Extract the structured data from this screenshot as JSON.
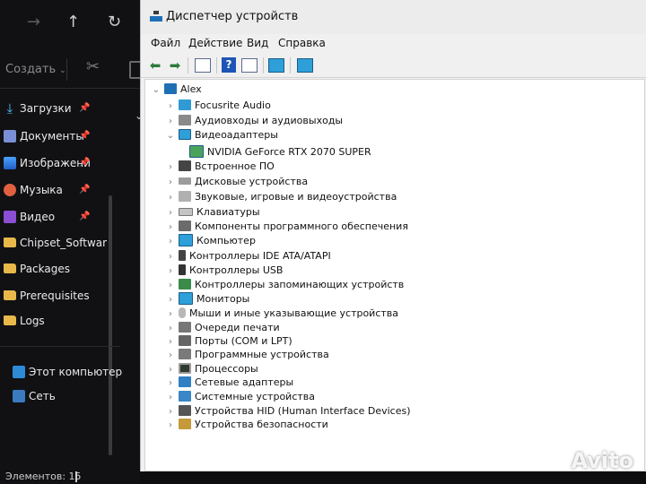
{
  "explorer": {
    "toolbar": {
      "create_label": "Создать"
    },
    "nav": [
      {
        "label": "Загрузки"
      },
      {
        "label": "Документы"
      },
      {
        "label": "Изображени"
      },
      {
        "label": "Музыка"
      },
      {
        "label": "Видео"
      },
      {
        "label": "Chipset_Softwar"
      },
      {
        "label": "Packages"
      },
      {
        "label": "Prerequisites"
      },
      {
        "label": "Logs"
      },
      {
        "label": "Этот компьютер"
      },
      {
        "label": "Сеть"
      }
    ],
    "status": "Элементов: 15"
  },
  "devmgr": {
    "title": "Диспетчер устройств",
    "menu": [
      "Файл",
      "Действие",
      "Вид",
      "Справка"
    ],
    "tree": {
      "root": "Alex",
      "items": [
        {
          "label": "Focusrite Audio"
        },
        {
          "label": "Аудиовходы и аудиовыходы"
        },
        {
          "label": "Видеоадаптеры"
        },
        {
          "label": "NVIDIA GeForce RTX 2070 SUPER"
        },
        {
          "label": "Встроенное ПО"
        },
        {
          "label": "Дисковые устройства"
        },
        {
          "label": "Звуковые, игровые и видеоустройства"
        },
        {
          "label": "Клавиатуры"
        },
        {
          "label": "Компоненты программного обеспечения"
        },
        {
          "label": "Компьютер"
        },
        {
          "label": "Контроллеры IDE ATA/ATAPI"
        },
        {
          "label": "Контроллеры USB"
        },
        {
          "label": "Контроллеры запоминающих устройств"
        },
        {
          "label": "Мониторы"
        },
        {
          "label": "Мыши и иные указывающие устройства"
        },
        {
          "label": "Очереди печати"
        },
        {
          "label": "Порты (COM и LPT)"
        },
        {
          "label": "Программные устройства"
        },
        {
          "label": "Процессоры"
        },
        {
          "label": "Сетевые адаптеры"
        },
        {
          "label": "Системные устройства"
        },
        {
          "label": "Устройства HID (Human Interface Devices)"
        },
        {
          "label": "Устройства безопасности"
        }
      ]
    }
  },
  "watermark": "Avito"
}
